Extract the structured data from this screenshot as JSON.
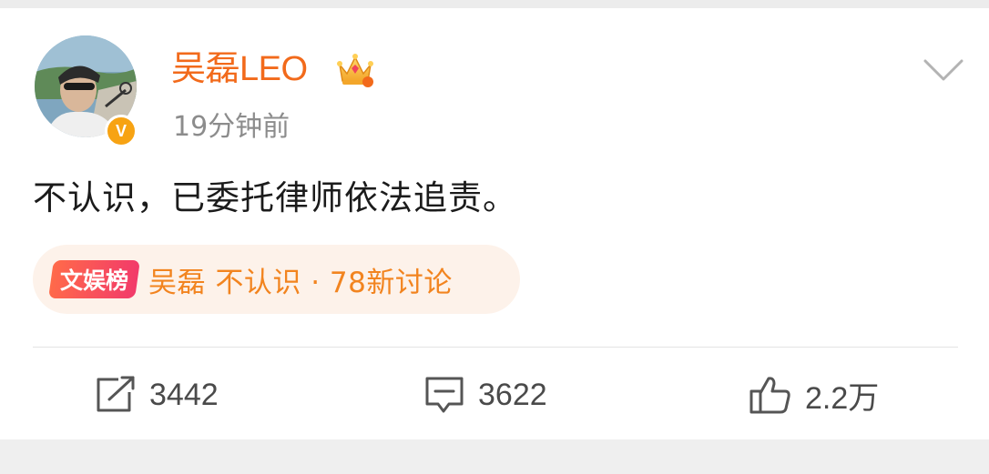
{
  "post": {
    "username": "吴磊LEO",
    "timestamp": "19分钟前",
    "verified_badge": "V",
    "content": "不认识，已委托律师依法追责。"
  },
  "topic": {
    "tag": "文娱榜",
    "text": "吴磊 不认识 · 78新讨论"
  },
  "actions": {
    "repost_count": "3442",
    "comment_count": "3622",
    "like_count": "2.2万"
  },
  "icons": {
    "avatar": "avatar-photo",
    "verified": "verified-v-badge",
    "vip": "crown-icon",
    "menu": "chevron-down-icon",
    "repost": "repost-icon",
    "comment": "comment-icon",
    "like": "thumbs-up-icon"
  },
  "colors": {
    "username": "#f26a1b",
    "topic_text": "#f2841f",
    "topic_bg": "#fdf2ea",
    "badge": "#f7a313"
  }
}
